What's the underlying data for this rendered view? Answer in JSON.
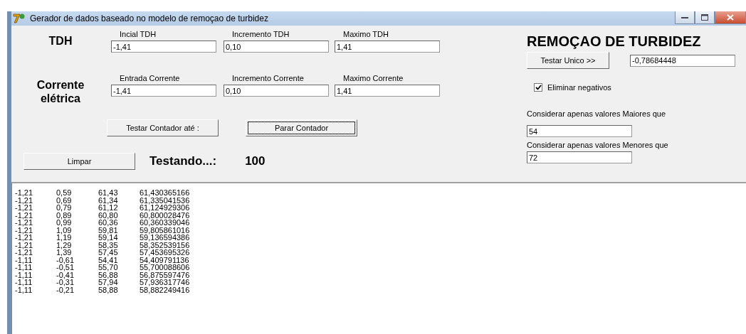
{
  "window": {
    "title": "Gerador de dados baseado no modelo de remoçao de turbidez"
  },
  "groups": [
    {
      "title": "TDH",
      "fields": [
        {
          "label": "Incial TDH",
          "value": "-1,41"
        },
        {
          "label": "Incremento TDH",
          "value": "0,10"
        },
        {
          "label": "Maximo TDH",
          "value": "1,41"
        }
      ]
    },
    {
      "title": "Corrente elétrica",
      "fields": [
        {
          "label": "Entrada Corrente",
          "value": "-1,41"
        },
        {
          "label": "Incremento Corrente",
          "value": "0,10"
        },
        {
          "label": "Maximo Corrente",
          "value": "1,41"
        }
      ]
    }
  ],
  "counter_buttons": [
    {
      "label": "Testar Contador até :",
      "focused": false
    },
    {
      "label": "Parar Contador",
      "focused": true
    }
  ],
  "clear_button": "Limpar",
  "status": {
    "label": "Testando...:",
    "count": "100"
  },
  "side": {
    "title": "REMOÇAO DE TURBIDEZ",
    "test_button": "Testar Unico >>",
    "result": "-0,78684448",
    "checkbox": {
      "label": "Eliminar negativos",
      "checked": true
    },
    "min_label": "Considerar apenas valores Maiores que",
    "min_value": "54",
    "max_label": "Considerar apenas valores Menores que",
    "max_value": "72"
  },
  "results": [
    [
      "-1,21",
      "0,59",
      "61,43",
      "61,430365166"
    ],
    [
      "-1,21",
      "0,69",
      "61,34",
      "61,335041536"
    ],
    [
      "-1,21",
      "0,79",
      "61,12",
      "61,124929306"
    ],
    [
      "-1,21",
      "0,89",
      "60,80",
      "60,800028476"
    ],
    [
      "-1,21",
      "0,99",
      "60,36",
      "60,360339046"
    ],
    [
      "-1,21",
      "1,09",
      "59,81",
      "59,805861016"
    ],
    [
      "-1,21",
      "1,19",
      "59,14",
      "59,136594386"
    ],
    [
      "-1,21",
      "1,29",
      "58,35",
      "58,352539156"
    ],
    [
      "-1,21",
      "1,39",
      "57,45",
      "57,453695326"
    ],
    [
      "-1,11",
      "-0,61",
      "54,41",
      "54,409791136"
    ],
    [
      "-1,11",
      "-0,51",
      "55,70",
      "55,700088606"
    ],
    [
      "-1,11",
      "-0,41",
      "56,88",
      "56,875597476"
    ],
    [
      "-1,11",
      "-0,31",
      "57,94",
      "57,936317746"
    ],
    [
      "-1,11",
      "-0,21",
      "58,88",
      "58,882249416"
    ]
  ]
}
